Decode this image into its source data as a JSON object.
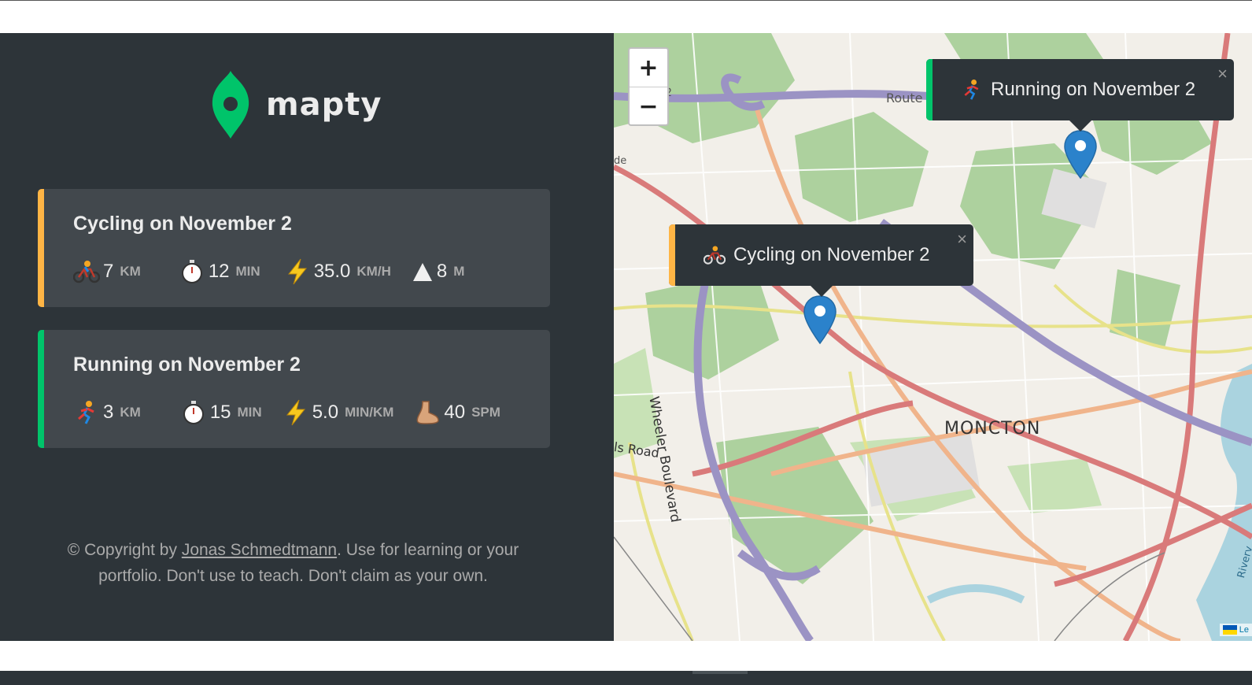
{
  "app": {
    "name": "mapty",
    "brand_color": "#00c46a"
  },
  "colors": {
    "sidebar_bg": "#2d3439",
    "card_bg": "#42484d",
    "cycling": "#ffb545",
    "running": "#00c46a",
    "text": "#ececec",
    "muted": "#aaaaaa"
  },
  "workouts": [
    {
      "title": "Cycling on November 2",
      "type": "cycling",
      "details": [
        {
          "icon": "bike-icon",
          "value": "7",
          "unit": "km"
        },
        {
          "icon": "stopwatch-icon",
          "value": "12",
          "unit": "min"
        },
        {
          "icon": "lightning-icon",
          "value": "35.0",
          "unit": "km/h"
        },
        {
          "icon": "mountain-icon",
          "value": "8",
          "unit": "m"
        }
      ]
    },
    {
      "title": "Running on November 2",
      "type": "running",
      "details": [
        {
          "icon": "runner-icon",
          "value": "3",
          "unit": "km"
        },
        {
          "icon": "stopwatch-icon",
          "value": "15",
          "unit": "min"
        },
        {
          "icon": "lightning-icon",
          "value": "5.0",
          "unit": "min/km"
        },
        {
          "icon": "foot-icon",
          "value": "40",
          "unit": "spm"
        }
      ]
    }
  ],
  "copyright": {
    "prefix": "© Copyright by ",
    "author": "Jonas Schmedtmann",
    "suffix": ". Use for learning or your portfolio. Don't use to teach. Don't claim as your own."
  },
  "map": {
    "zoom_in": "+",
    "zoom_out": "−",
    "popups": [
      {
        "text": "Running on November 2",
        "icon": "runner-icon",
        "type": "running",
        "close": "×"
      },
      {
        "text": "Cycling on November 2",
        "icon": "bike-icon",
        "type": "cycling",
        "close": "×"
      }
    ],
    "labels": {
      "city": "MONCTON",
      "road1": "Wheeler Boulevard",
      "road2": "Route",
      "road3": "ls Road",
      "road4": "Riverv",
      "road5": "e 2",
      "road6": "de"
    },
    "attribution": "Le"
  }
}
